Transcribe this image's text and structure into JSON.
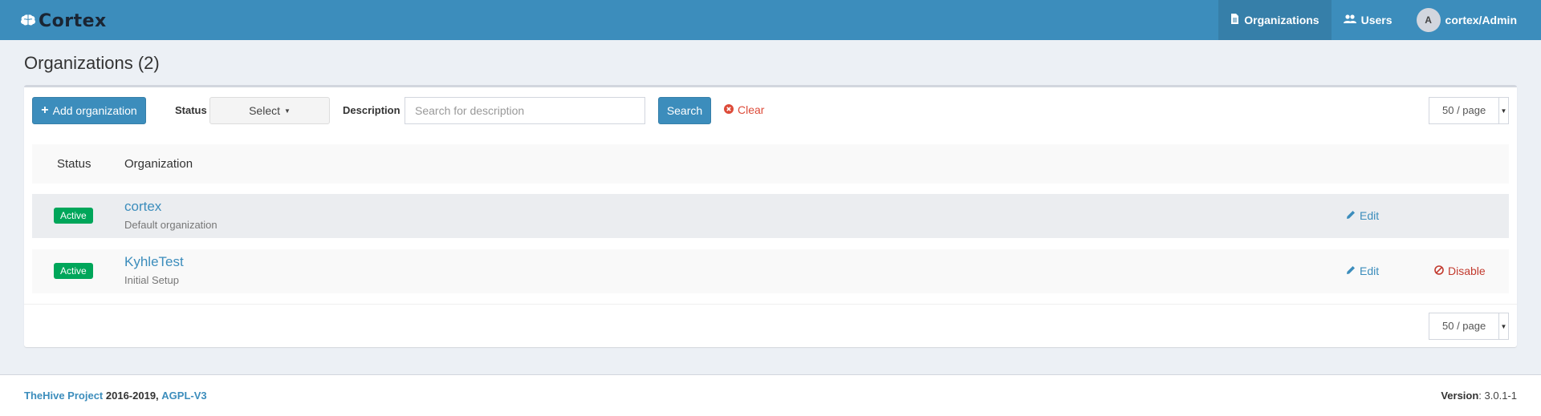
{
  "brand": {
    "name": "Cortex",
    "icon": "brain-icon"
  },
  "nav": {
    "items": [
      {
        "label": "Organizations",
        "icon": "file-icon",
        "active": true
      },
      {
        "label": "Users",
        "icon": "users-icon",
        "active": false
      }
    ],
    "user": {
      "avatar_initial": "A",
      "label": "cortex/Admin"
    }
  },
  "page": {
    "title": "Organizations (2)"
  },
  "toolbar": {
    "add_label": "Add organization",
    "status_label": "Status",
    "status_select": "Select",
    "description_label": "Description",
    "description_placeholder": "Search for description",
    "description_value": "",
    "search_label": "Search",
    "clear_label": "Clear",
    "page_size": "50 / page"
  },
  "table": {
    "columns": [
      "Status",
      "Organization"
    ],
    "rows": [
      {
        "status": "Active",
        "name": "cortex",
        "description": "Default organization",
        "edit": "Edit",
        "disable": ""
      },
      {
        "status": "Active",
        "name": "KyhleTest",
        "description": "Initial Setup",
        "edit": "Edit",
        "disable": "Disable"
      }
    ]
  },
  "pagination": {
    "page_size": "50 / page"
  },
  "footer": {
    "project_link": "TheHive Project",
    "years": "2016-2019,",
    "license_link": "AGPL-V3",
    "version_label": "Version",
    "version_value": ": 3.0.1-1"
  },
  "colors": {
    "header": "#3c8dbc",
    "header_active": "#367fa9",
    "primary": "#3c8dbc",
    "success": "#00a65a",
    "danger": "#dd4b39",
    "background": "#ecf0f5"
  }
}
